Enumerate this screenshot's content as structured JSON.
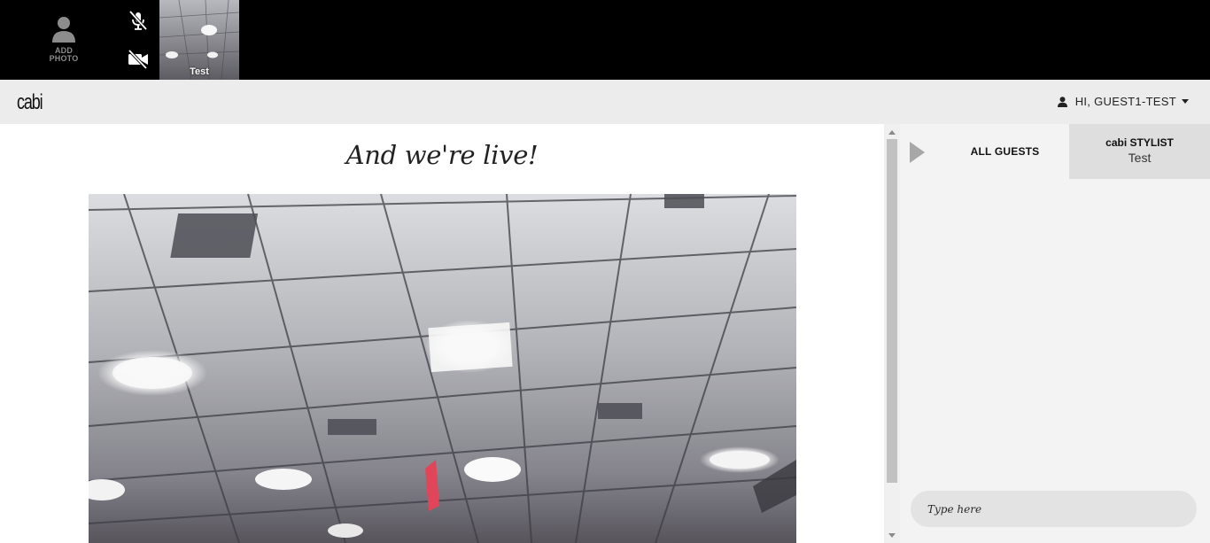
{
  "video_strip": {
    "add_photo_label_line1": "ADD",
    "add_photo_label_line2": "PHOTO",
    "mic_icon": "microphone-muted-icon",
    "video_icon": "video-camera-off-icon",
    "participant_name": "Test"
  },
  "header": {
    "logo_text": "cabi",
    "user_greeting": "HI, GUEST1-TEST"
  },
  "main": {
    "heading": "And we're live!"
  },
  "sidebar": {
    "tab_all_guests": "ALL GUESTS",
    "tab_stylist_title": "cabi STYLIST",
    "tab_stylist_name": "Test",
    "chat_placeholder": "Type here"
  },
  "colors": {
    "top_strip_bg": "#000000",
    "nav_bg": "#ececec",
    "sidebar_bg": "#f3f3f3",
    "active_tab_bg": "#dedede"
  }
}
